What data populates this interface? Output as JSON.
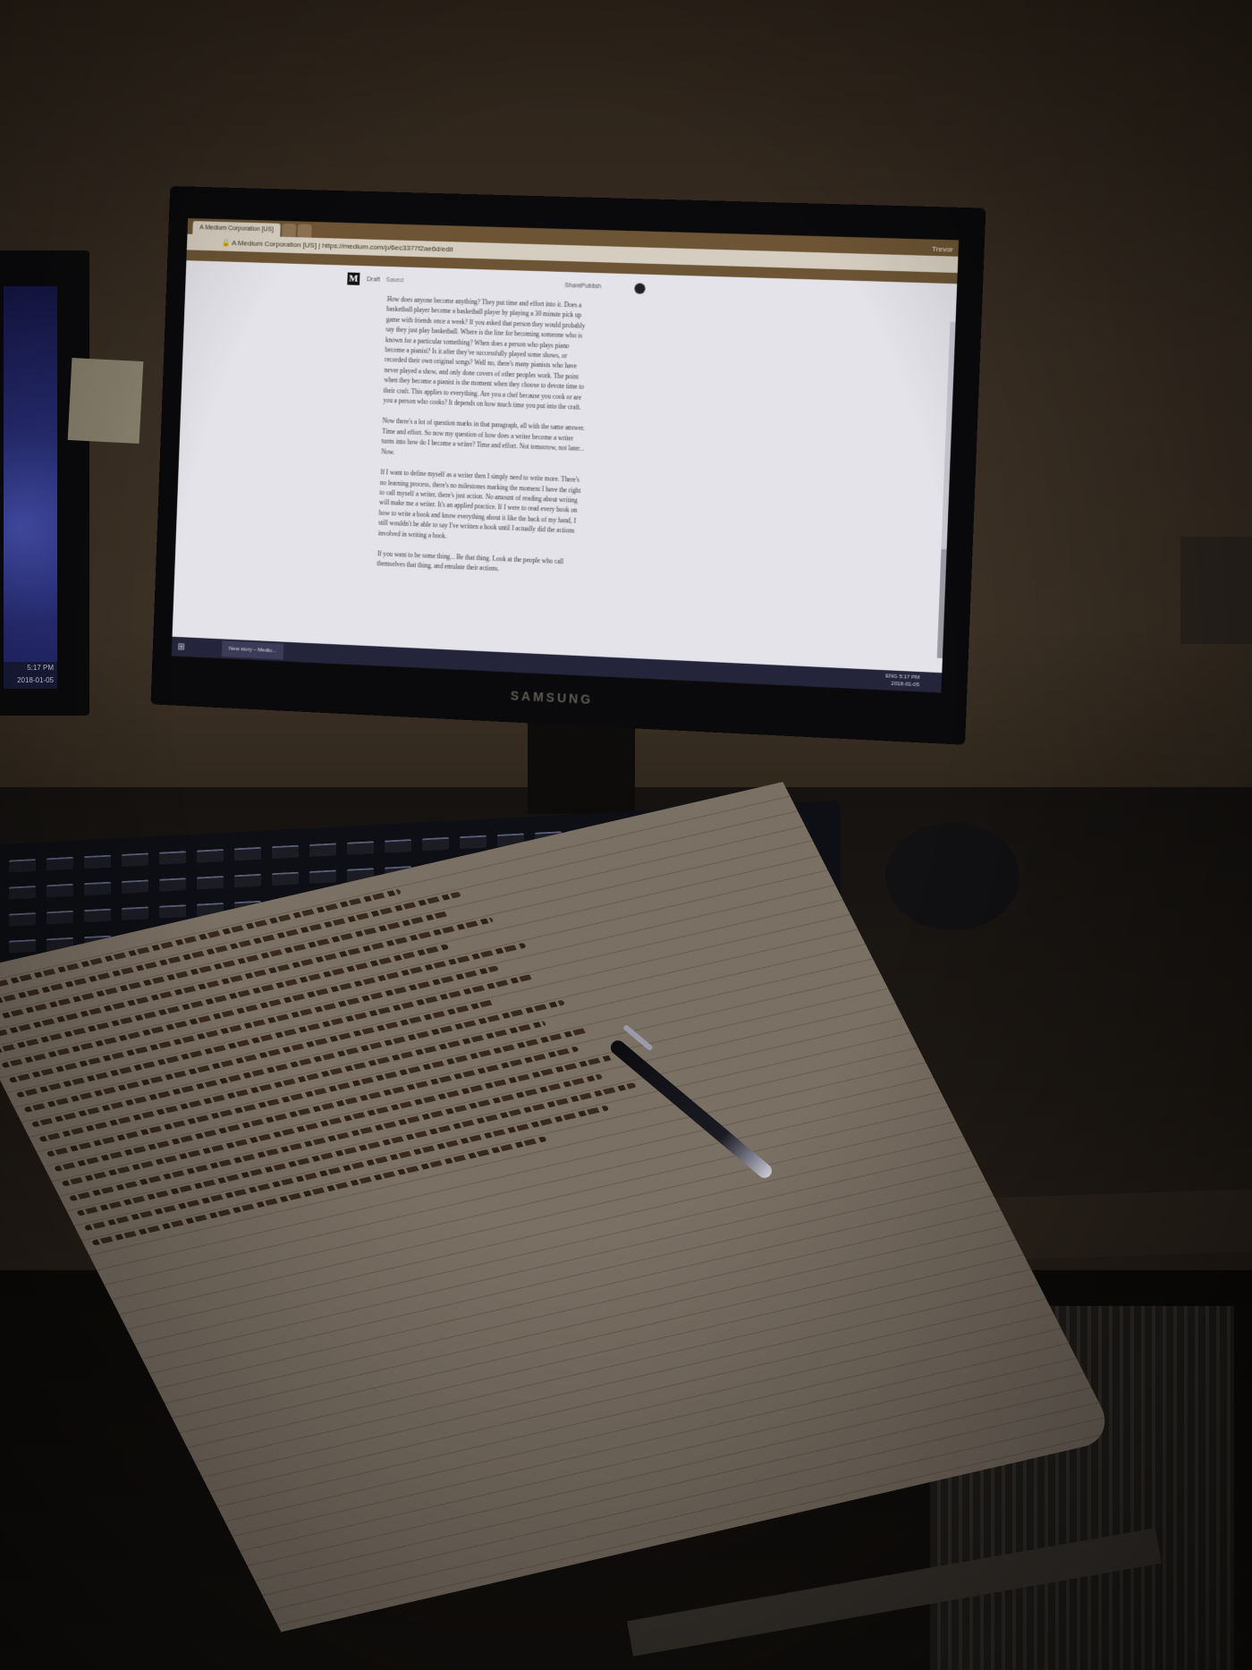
{
  "browser": {
    "tabs": [
      "A Medium Corporation [US]",
      "",
      ""
    ],
    "user_name": "Trevor",
    "url_site": "A Medium Corporation [US]",
    "url": "https://medium.com/p/6ec3377f2ae6d/edit"
  },
  "medium": {
    "logo": "M",
    "draft_label": "Draft",
    "saved_label": "Saved",
    "share_label": "Share",
    "publish_label": "Publish"
  },
  "article": {
    "paragraphs": [
      "How does anyone become anything? They put time and effort into it. Does a basketball player become a basketball player by playing a 30 minute pick up game with friends once a week? If you asked that person they would probably say they just play basketball. Where is the line for becoming someone who is known for a particular something? When does a person who plays piano become a pianist? Is it after they've successfully played some shows, or recorded their own original songs? Well no, there's many pianists who have never played a show, and only done covers of other peoples work. The point when they become a pianist is the moment when they choose to devote time to their craft. This applies to everything. Are you a chef because you cook or are you a person who cooks? It depends on how much time you put into the craft.",
      "Now there's a lot of question marks in that paragraph, all with the same answer. Time and effort. So now my question of how does a writer become a writer turns into how do I become a writer? Time and effort. Not tomorrow, not later... Now.",
      "If I want to define myself as a writer then I simply need to write more. There's no learning process, there's no milestones marking the moment I have the right to call myself a writer, there's just action. No amount of reading about writing will make me a writer. It's an applied practice. If I were to read every book on how to write a book and know everything about it like the back of my hand, I still wouldn't be able to say I've written a book until I actually did the actions involved in writing a book.",
      "If you want to be some thing... Be that thing. Look at the people who call themselves that thing, and emulate their actions."
    ]
  },
  "taskbar": {
    "start_icon": "windows-start-icon",
    "active_app": "New story – Mediu...",
    "language": "ENG",
    "time": "5:17 PM",
    "date": "2018-01-05"
  },
  "left_monitor": {
    "time": "5:17 PM",
    "date": "2018-01-05"
  },
  "monitor_brand": "SAMSUNG"
}
